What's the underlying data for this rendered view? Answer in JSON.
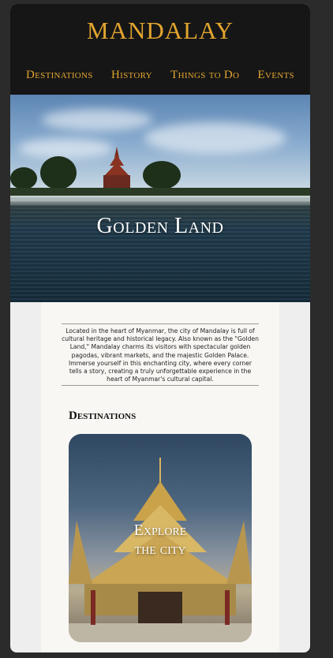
{
  "header": {
    "brand": "MANDALAY",
    "nav": [
      "Destinations",
      "History",
      "Things to Do",
      "Events"
    ]
  },
  "hero": {
    "title": "Golden Land"
  },
  "intro": {
    "text": "Located in the heart of Myanmar, the city of Mandalay is full of cultural heritage and historical legacy. Also known as the \"Golden Land,\" Mandalay charms its visitors with spectacular golden pagodas, vibrant markets, and the majestic Golden Palace. Immerse yourself in this enchanting city, where every corner tells a story, creating a truly unforgettable experience in the heart of Myanmar's cultural capital."
  },
  "destinations": {
    "title": "Destinations",
    "card_label_line1": "Explore",
    "card_label_line2": "the city"
  },
  "colors": {
    "accent_gold": "#e2a52f",
    "header_bg": "#161616",
    "content_bg": "#f8f7f4"
  }
}
